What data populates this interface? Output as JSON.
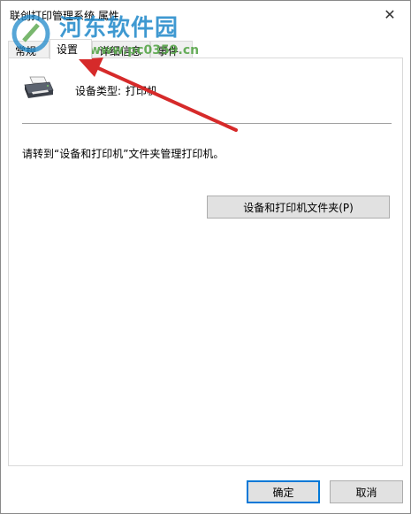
{
  "window": {
    "title": "联创打印管理系统 属性",
    "close_glyph": "✕"
  },
  "tabs": [
    {
      "label": "常规",
      "active": false
    },
    {
      "label": "设置",
      "active": true
    },
    {
      "label": "详细信息",
      "active": false
    },
    {
      "label": "事件",
      "active": false
    }
  ],
  "panel": {
    "device_type_label": "设备类型:",
    "device_type_value": "打印机",
    "hint_text": "请转到“设备和打印机”文件夹管理打印机。",
    "folder_button_label": "设备和打印机文件夹(P)"
  },
  "footer": {
    "ok_label": "确定",
    "cancel_label": "取消"
  },
  "watermark": {
    "text": "河东软件园",
    "url": "www.pc0359.cn"
  },
  "colors": {
    "accent": "#0078d7",
    "annotation_arrow": "#d62a2a",
    "watermark_blue": "#1e88c9",
    "watermark_green": "#58a64a"
  },
  "icons": {
    "device": "printer-icon",
    "close": "close-icon",
    "annotation": "red-arrow"
  }
}
